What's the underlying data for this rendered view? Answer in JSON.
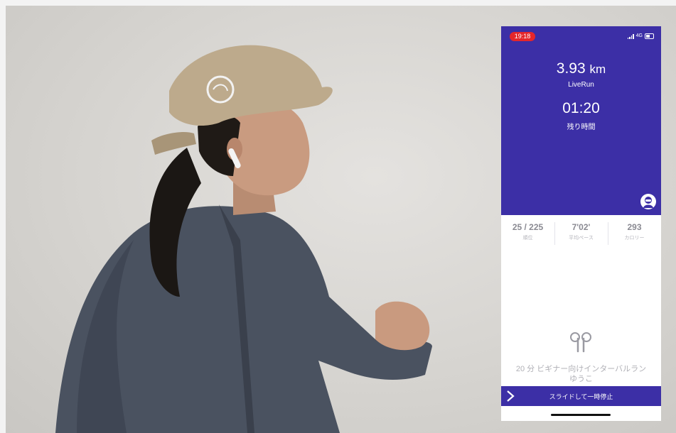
{
  "status_bar": {
    "time": "19:18",
    "network": "4G"
  },
  "run": {
    "distance_value": "3.93",
    "distance_unit": "km",
    "mode_label": "LiveRun",
    "remaining_time": "01:20",
    "remaining_label": "残り時間"
  },
  "stats": [
    {
      "value": "25 / 225",
      "label": "順位"
    },
    {
      "value": "7'02'",
      "label": "平均ペース"
    },
    {
      "value": "293",
      "label": "カロリー"
    }
  ],
  "workout": {
    "title": "20 分 ビギナー向けインターバルラン",
    "coach": "ゆうこ"
  },
  "slider": {
    "label": "スライドして一時停止"
  },
  "icons": {
    "coach": "coach-avatar-icon",
    "earbuds": "earbuds-icon",
    "slide": "chevron-right-icon"
  },
  "colors": {
    "accent": "#3c2fa6",
    "status_pill": "#e5262b"
  }
}
